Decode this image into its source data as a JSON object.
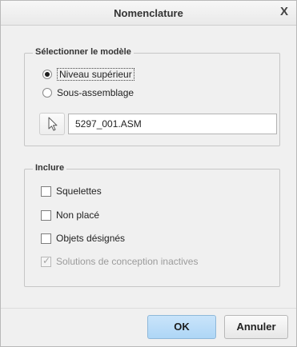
{
  "window": {
    "title": "Nomenclature",
    "close_symbol": "X"
  },
  "select_model": {
    "legend": "Sélectionner le modèle",
    "options": [
      {
        "label": "Niveau supérieur",
        "selected": true
      },
      {
        "label": "Sous-assemblage",
        "selected": false
      }
    ],
    "model_name": "5297_001.ASM"
  },
  "include": {
    "legend": "Inclure",
    "options": [
      {
        "label": "Squelettes",
        "checked": false,
        "disabled": false
      },
      {
        "label": "Non placé",
        "checked": false,
        "disabled": false
      },
      {
        "label": "Objets désignés",
        "checked": false,
        "disabled": false
      },
      {
        "label": "Solutions de conception inactives",
        "checked": true,
        "disabled": true
      }
    ]
  },
  "buttons": {
    "ok": "OK",
    "cancel": "Annuler"
  },
  "colors": {
    "ok_button": "#aed6f6",
    "background": "#f0f0f0"
  }
}
